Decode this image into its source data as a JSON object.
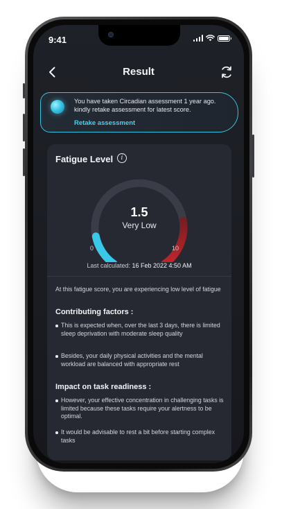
{
  "status_bar": {
    "time": "9:41"
  },
  "header": {
    "title": "Result"
  },
  "banner": {
    "message": "You have taken Circadian assessment 1 year ago. kindly retake assessment for latest score.",
    "link": "Retake assessment"
  },
  "fatigue": {
    "title": "Fatigue Level",
    "score": "1.5",
    "level": "Very Low",
    "scale_min": "0",
    "scale_max": "10",
    "score_fraction": 0.15,
    "last_calculated_label": "Last calculated:",
    "last_calculated_value": "16 Feb 2022 4:50 AM",
    "summary": "At this fatigue score, you are experiencing low level of fatigue"
  },
  "contributing": {
    "heading": "Contributing factors :",
    "items": [
      "This is expected when, over the last 3 days, there is limited sleep deprivation with moderate sleep quality",
      "Besides, your daily physical activities and the mental workload are balanced with appropriate rest"
    ]
  },
  "impact": {
    "heading": "Impact on task readiness :",
    "items": [
      "However, your effective concentration in challenging tasks is limited because these tasks require your alertness to be optimal.",
      "It would be advisable to rest a bit before starting complex tasks"
    ]
  },
  "colors": {
    "accent": "#35c3e6",
    "gauge_low": "#39c8ea",
    "gauge_high": "#c2262b",
    "gauge_track": "#3a3d47",
    "card": "#262932"
  },
  "icons": {
    "back": "chevron-left-icon",
    "refresh": "refresh-icon",
    "info": "info-icon",
    "globe": "globe-icon"
  }
}
